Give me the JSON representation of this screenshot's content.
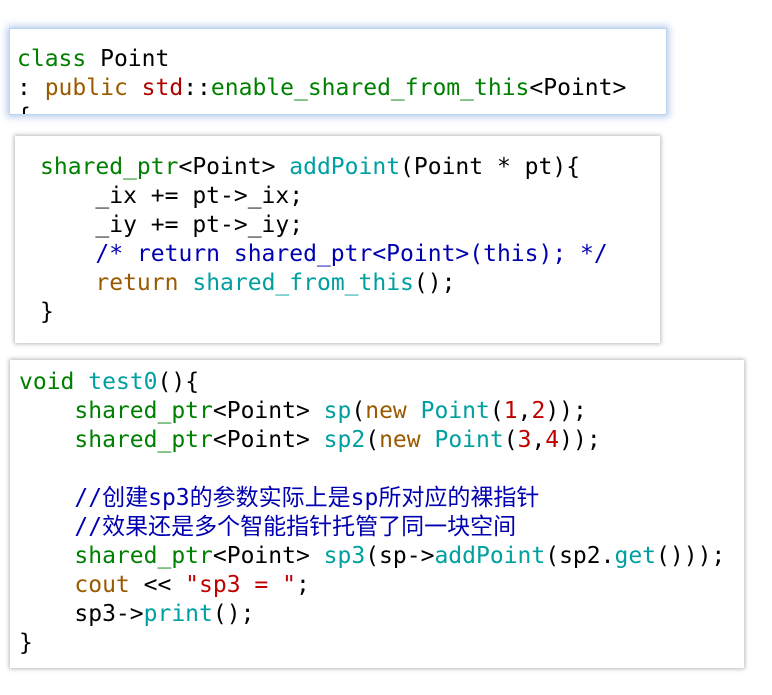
{
  "colors": {
    "default": "#000000",
    "keyword_green": "#008000",
    "keyword_brown": "#9a5a00",
    "namespace_red": "#b00000",
    "identifier_teal": "#00a0a0",
    "comment_blue": "#0000b0",
    "number_red": "#c00000",
    "string_red": "#c00000"
  },
  "panels": [
    {
      "lines": [
        [
          [
            "class",
            "keyword_green"
          ],
          [
            " Point",
            "default"
          ]
        ],
        [
          [
            ": ",
            "default"
          ],
          [
            "public",
            "keyword_brown"
          ],
          [
            " ",
            "default"
          ],
          [
            "std",
            "namespace_red"
          ],
          [
            "::",
            "default"
          ],
          [
            "enable_shared_from_this",
            "keyword_green"
          ],
          [
            "<Point>",
            "default"
          ]
        ],
        [
          [
            "{",
            "default"
          ]
        ]
      ]
    },
    {
      "lines": [
        [
          [
            "shared_ptr",
            "keyword_green"
          ],
          [
            "<Point> ",
            "default"
          ],
          [
            "addPoint",
            "identifier_teal"
          ],
          [
            "(Point * pt){",
            "default"
          ]
        ],
        [
          [
            "    _ix += pt->_ix;",
            "default"
          ]
        ],
        [
          [
            "    _iy += pt->_iy;",
            "default"
          ]
        ],
        [
          [
            "    /* return shared_ptr<Point>(this); */",
            "comment_blue"
          ]
        ],
        [
          [
            "    ",
            "default"
          ],
          [
            "return",
            "keyword_brown"
          ],
          [
            " ",
            "default"
          ],
          [
            "shared_from_this",
            "identifier_teal"
          ],
          [
            "();",
            "default"
          ]
        ],
        [
          [
            "}",
            "default"
          ]
        ]
      ]
    },
    {
      "lines": [
        [
          [
            "void",
            "keyword_green"
          ],
          [
            " ",
            "default"
          ],
          [
            "test0",
            "identifier_teal"
          ],
          [
            "(){",
            "default"
          ]
        ],
        [
          [
            "    ",
            "default"
          ],
          [
            "shared_ptr",
            "keyword_green"
          ],
          [
            "<Point> ",
            "default"
          ],
          [
            "sp",
            "identifier_teal"
          ],
          [
            "(",
            "default"
          ],
          [
            "new",
            "keyword_brown"
          ],
          [
            " ",
            "default"
          ],
          [
            "Point",
            "identifier_teal"
          ],
          [
            "(",
            "default"
          ],
          [
            "1",
            "number_red"
          ],
          [
            ",",
            "default"
          ],
          [
            "2",
            "number_red"
          ],
          [
            "));",
            "default"
          ]
        ],
        [
          [
            "    ",
            "default"
          ],
          [
            "shared_ptr",
            "keyword_green"
          ],
          [
            "<Point> ",
            "default"
          ],
          [
            "sp2",
            "identifier_teal"
          ],
          [
            "(",
            "default"
          ],
          [
            "new",
            "keyword_brown"
          ],
          [
            " ",
            "default"
          ],
          [
            "Point",
            "identifier_teal"
          ],
          [
            "(",
            "default"
          ],
          [
            "3",
            "number_red"
          ],
          [
            ",",
            "default"
          ],
          [
            "4",
            "number_red"
          ],
          [
            "));",
            "default"
          ]
        ],
        [
          [
            "",
            "default"
          ]
        ],
        [
          [
            "    //创建sp3的参数实际上是sp所对应的裸指针",
            "comment_blue"
          ]
        ],
        [
          [
            "    //效果还是多个智能指针托管了同一块空间",
            "comment_blue"
          ]
        ],
        [
          [
            "    ",
            "default"
          ],
          [
            "shared_ptr",
            "keyword_green"
          ],
          [
            "<Point> ",
            "default"
          ],
          [
            "sp3",
            "identifier_teal"
          ],
          [
            "(sp->",
            "default"
          ],
          [
            "addPoint",
            "identifier_teal"
          ],
          [
            "(sp2.",
            "default"
          ],
          [
            "get",
            "identifier_teal"
          ],
          [
            "()));",
            "default"
          ]
        ],
        [
          [
            "    ",
            "default"
          ],
          [
            "cout",
            "keyword_brown"
          ],
          [
            " << ",
            "default"
          ],
          [
            "\"sp3 = \"",
            "string_red"
          ],
          [
            ";",
            "default"
          ]
        ],
        [
          [
            "    sp3->",
            "default"
          ],
          [
            "print",
            "identifier_teal"
          ],
          [
            "();",
            "default"
          ]
        ],
        [
          [
            "}",
            "default"
          ]
        ]
      ]
    }
  ]
}
